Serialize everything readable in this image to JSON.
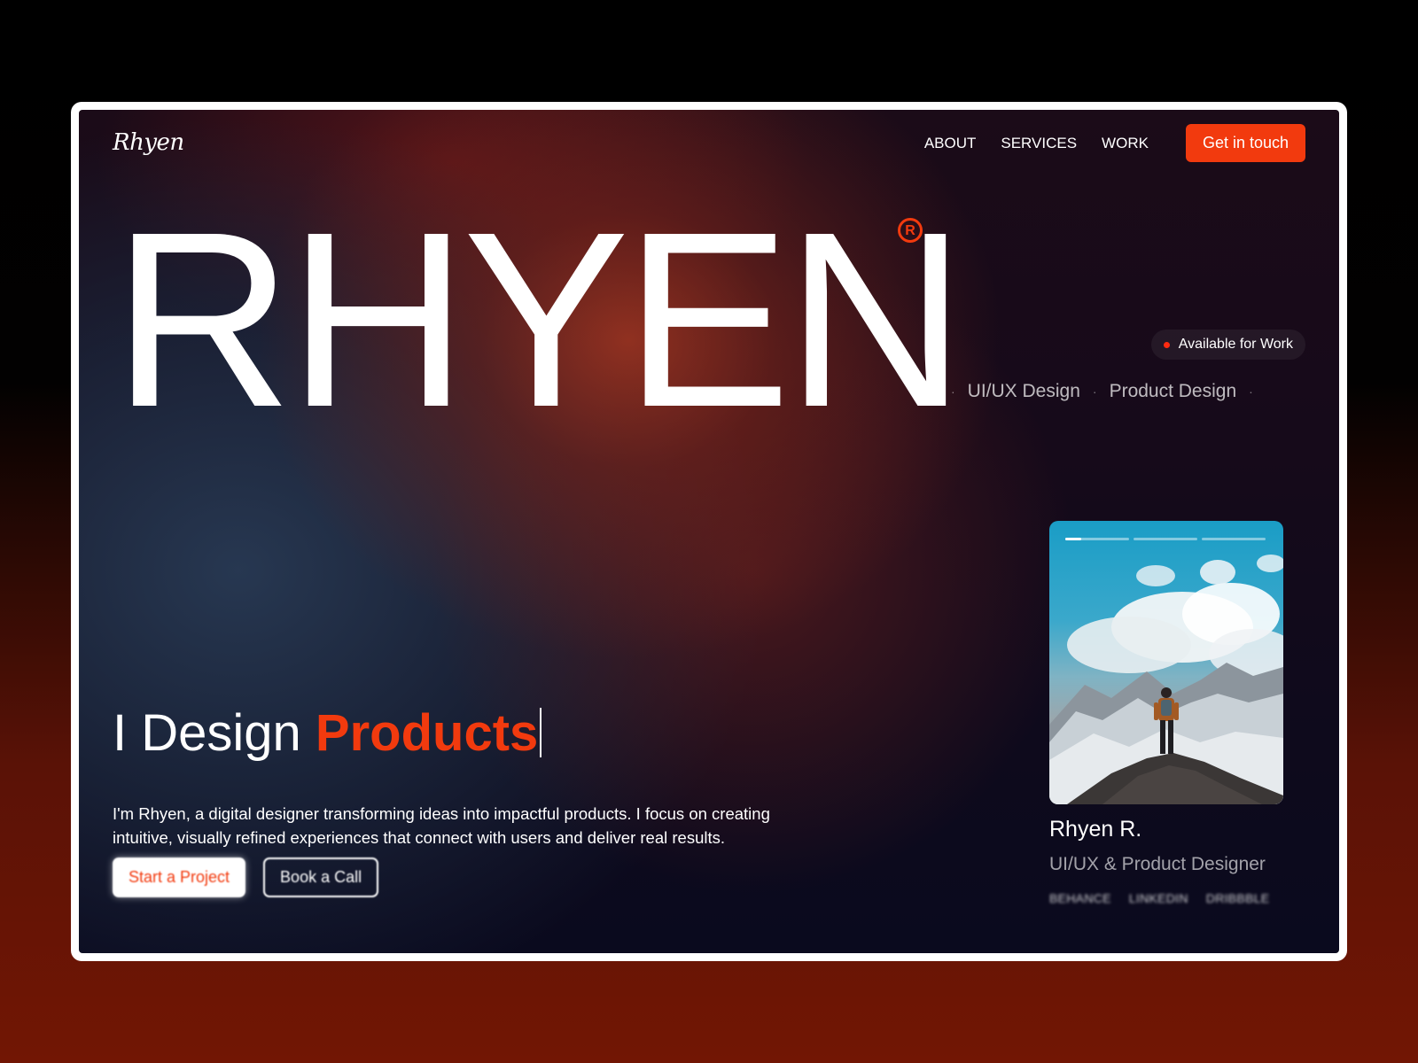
{
  "header": {
    "logo": "Rhyen",
    "nav": [
      "ABOUT",
      "SERVICES",
      "WORK"
    ],
    "cta": "Get in touch"
  },
  "hero": {
    "brand": "RHYEN",
    "registered_mark": "R",
    "availability": "Available for Work",
    "tags": [
      "UI/UX Design",
      "Product Design"
    ],
    "separator": "·",
    "headline_prefix": "I Design",
    "headline_accent": "Products",
    "description": "I'm Rhyen, a digital designer transforming ideas into impactful products. I focus on creating intuitive, visually refined experiences that connect with users and deliver real results.",
    "primary_button": "Start a Project",
    "secondary_button": "Book a Call"
  },
  "profile": {
    "name": "Rhyen R.",
    "role": "UI/UX & Product Designer",
    "socials": [
      "BEHANCE",
      "LINKEDIN",
      "DRIBBBLE"
    ],
    "slides_total": 3,
    "slide_progress": 0.25
  },
  "colors": {
    "accent": "#f23a0e",
    "status_dot": "#ff2a10"
  }
}
